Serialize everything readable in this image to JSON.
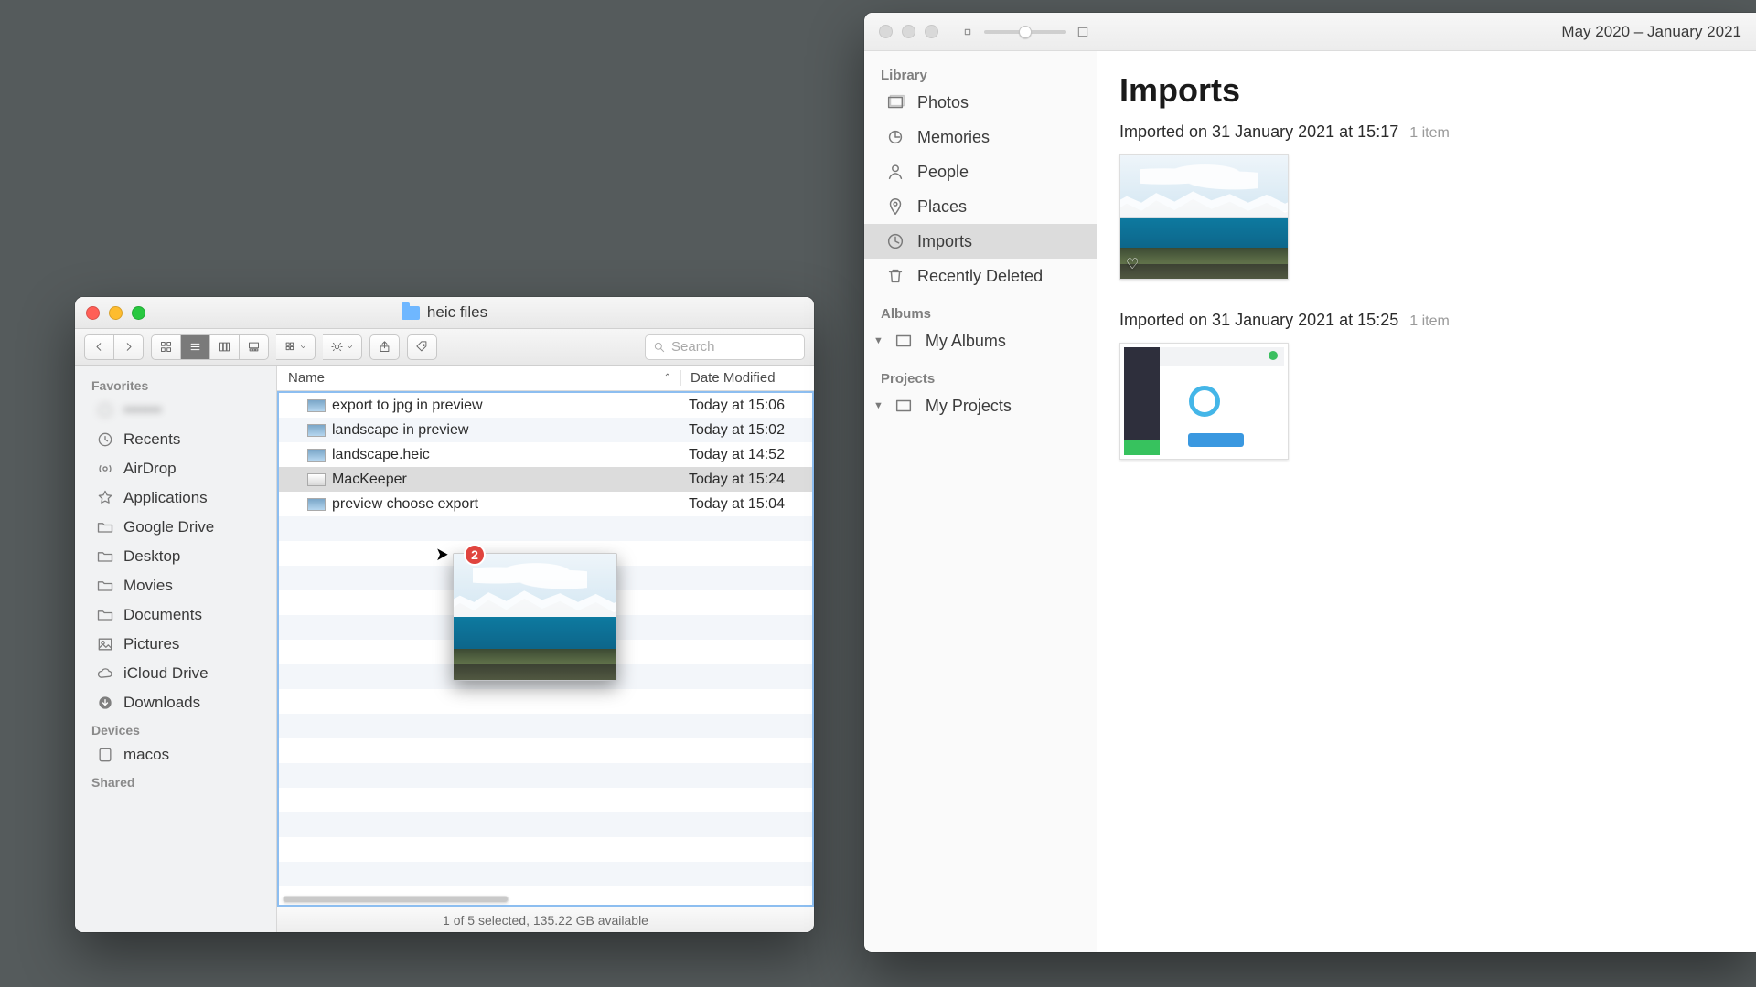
{
  "finder": {
    "title": "heic files",
    "search_placeholder": "Search",
    "columns": {
      "name": "Name",
      "date": "Date Modified"
    },
    "sidebar": {
      "favorites_header": "Favorites",
      "items": [
        {
          "label": "•••••••",
          "icon": "blur"
        },
        {
          "label": "Recents",
          "icon": "recents"
        },
        {
          "label": "AirDrop",
          "icon": "airdrop"
        },
        {
          "label": "Applications",
          "icon": "apps"
        },
        {
          "label": "Google Drive",
          "icon": "folder"
        },
        {
          "label": "Desktop",
          "icon": "folder"
        },
        {
          "label": "Movies",
          "icon": "folder"
        },
        {
          "label": "Documents",
          "icon": "folder"
        },
        {
          "label": "Pictures",
          "icon": "pictures"
        },
        {
          "label": "iCloud Drive",
          "icon": "icloud"
        },
        {
          "label": "Downloads",
          "icon": "downloads"
        }
      ],
      "devices_header": "Devices",
      "devices": [
        {
          "label": "macos",
          "icon": "disk"
        }
      ],
      "shared_header": "Shared"
    },
    "files": [
      {
        "name": "export to jpg in preview",
        "date": "Today at 15:06",
        "selected": false
      },
      {
        "name": "landscape in preview",
        "date": "Today at 15:02",
        "selected": false
      },
      {
        "name": "landscape.heic",
        "date": "Today at 14:52",
        "selected": false
      },
      {
        "name": "MacKeeper",
        "date": "Today at 15:24",
        "selected": true
      },
      {
        "name": "preview choose export",
        "date": "Today at 15:04",
        "selected": false
      }
    ],
    "status": "1 of 5 selected, 135.22 GB available",
    "drag_badge": "2"
  },
  "photos": {
    "title_range": "May 2020 – January 2021",
    "sidebar": {
      "library_header": "Library",
      "library": [
        {
          "label": "Photos"
        },
        {
          "label": "Memories"
        },
        {
          "label": "People"
        },
        {
          "label": "Places"
        },
        {
          "label": "Imports"
        },
        {
          "label": "Recently Deleted"
        }
      ],
      "albums_header": "Albums",
      "my_albums": "My Albums",
      "projects_header": "Projects",
      "my_projects": "My Projects"
    },
    "content": {
      "title": "Imports",
      "sections": [
        {
          "label": "Imported on 31 January 2021 at 15:17",
          "count": "1 item"
        },
        {
          "label": "Imported on 31 January 2021 at 15:25",
          "count": "1 item"
        }
      ]
    }
  }
}
